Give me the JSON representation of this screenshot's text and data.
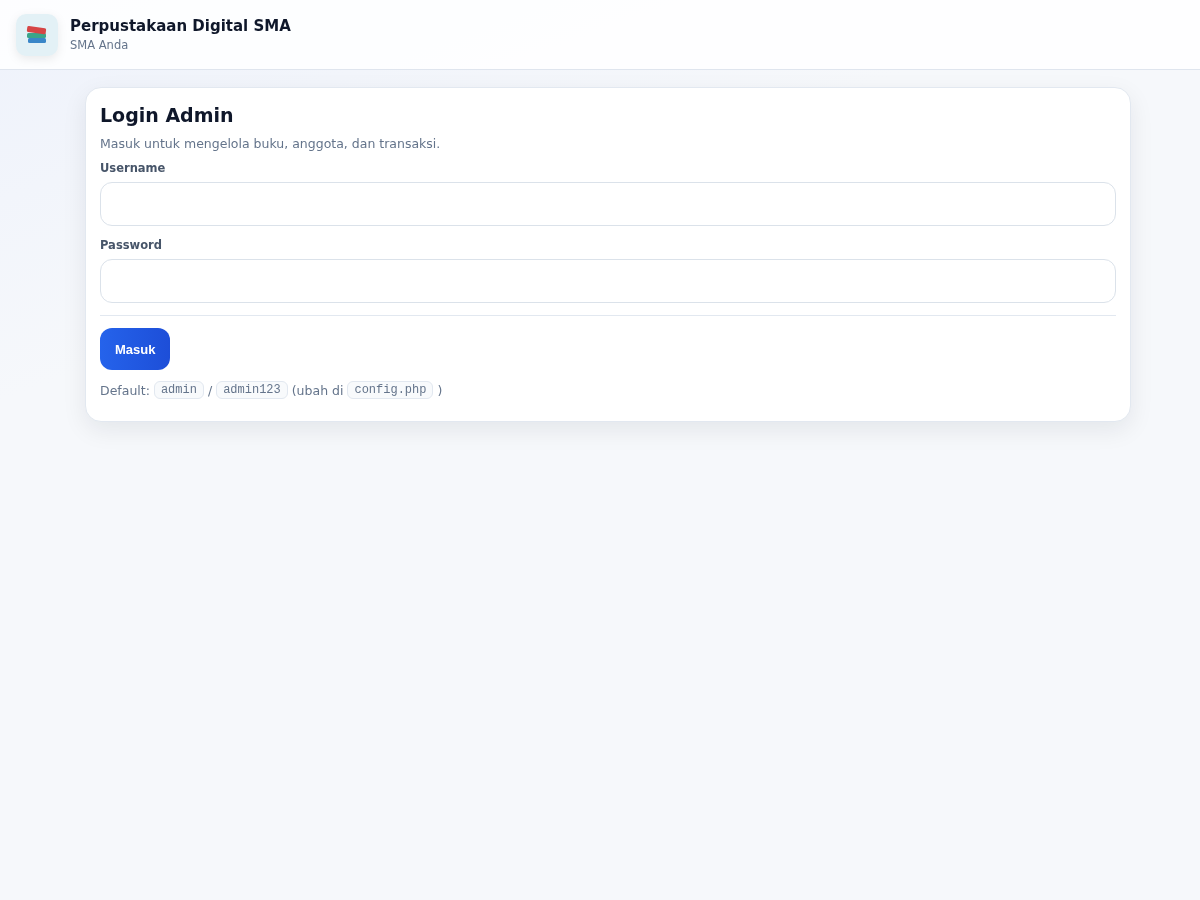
{
  "header": {
    "title": "Perpustakaan Digital SMA",
    "subtitle": "SMA Anda"
  },
  "login": {
    "title": "Login Admin",
    "description": "Masuk untuk mengelola buku, anggota, dan transaksi.",
    "fields": [
      {
        "label": "Username"
      },
      {
        "label": "Password"
      }
    ],
    "button": "Masuk",
    "hint": [
      {
        "kind": "text",
        "text": "Default:"
      },
      {
        "kind": "code",
        "text": "admin"
      },
      {
        "kind": "text",
        "text": "/"
      },
      {
        "kind": "code",
        "text": "admin123"
      },
      {
        "kind": "text",
        "text": "(ubah di"
      },
      {
        "kind": "code",
        "text": "config.php"
      },
      {
        "kind": "text",
        "text": ")"
      }
    ]
  }
}
